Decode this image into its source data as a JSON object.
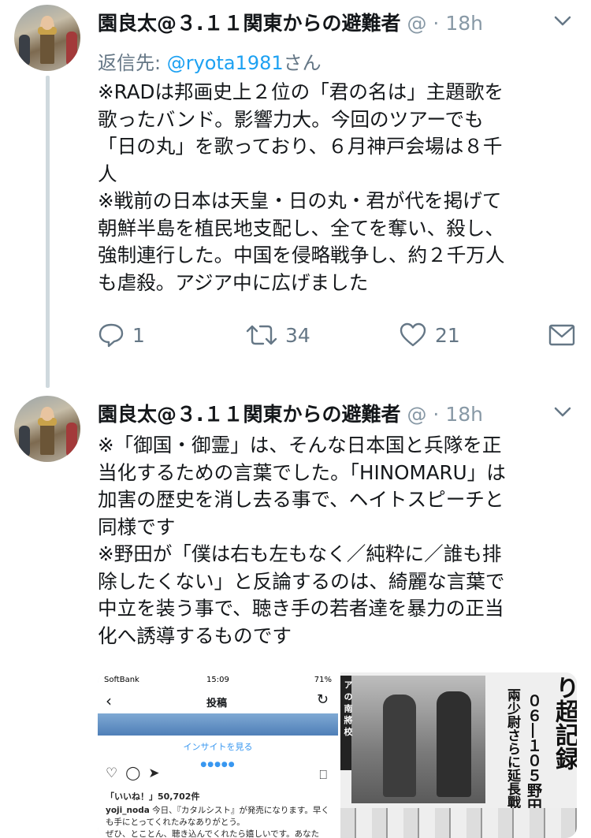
{
  "tweets": [
    {
      "name": "園良太@３.１１関東からの避難者",
      "handle": "@",
      "time": "18h",
      "reply_prefix": "返信先: ",
      "reply_handle": "@ryota1981",
      "reply_suffix": "さん",
      "lines": [
        "※RADは邦画史上２位の「君の名は」主題歌を",
        "歌ったバンド。影響力大。今回のツアーでも",
        "「日の丸」を歌っており、６月神戸会場は８千",
        "人",
        "※戦前の日本は天皇・日の丸・君が代を掲げて",
        "朝鮮半島を植民地支配し、全てを奪い、殺し、",
        "強制連行した。中国を侵略戦争し、約２千万人",
        "も虐殺。アジア中に広げました"
      ],
      "replies": "1",
      "retweets": "34",
      "likes": "21"
    },
    {
      "name": "園良太@３.１１関東からの避難者",
      "handle": "@",
      "time": "18h",
      "lines": [
        "※「御国・御霊」は、そんな日本国と兵隊を正",
        "当化するための言葉でした。「HINOMARU」は",
        "加害の歴史を消し去る事で、ヘイトスピーチと",
        "同様です",
        "※野田が「僕は右も左もなく／純粋に／誰も排",
        "除したくない」と反論するのは、綺麗な言葉で",
        "中立を装う事で、聴き手の若者達を暴力の正当",
        "化へ誘導するものです"
      ]
    }
  ],
  "media": {
    "instagram": {
      "carrier": "SoftBank",
      "clock": "15:09",
      "battery": "71%",
      "back_icon": "‹",
      "title": "投稿",
      "insight": "インサイトを見る",
      "likes": "「いいね！」50,702件",
      "caption_user": "yoji_noda",
      "caption_text": " 今日、『カタルシスト』が発売になります。早くも手にとってくれたみなありがとう。",
      "caption_text2": "ぜひ、とことん、聴き込んでくれたら嬉しいです。あなた"
    },
    "newspaper": {
      "headline_1": "り超記録",
      "headline_2": "０６―１０５野田",
      "headline_3": "兩少尉さらに延長戰",
      "side_text": "ア の 南 將 校"
    }
  },
  "colors": {
    "accent": "#1da1f2",
    "muted": "#657786",
    "thread_line": "#cfd9de"
  }
}
